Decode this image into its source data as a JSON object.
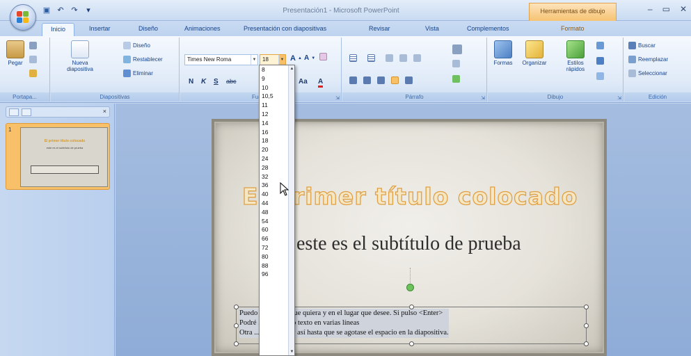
{
  "window": {
    "title": "Presentación1 - Microsoft PowerPoint",
    "context_tool": "Herramientas de dibujo",
    "controls": [
      "–",
      "▭",
      "✕"
    ]
  },
  "quick_access": [
    "save-icon",
    "undo-icon",
    "redo-icon",
    "customize-icon"
  ],
  "tabs": [
    {
      "label": "Inicio",
      "active": true
    },
    {
      "label": "Insertar"
    },
    {
      "label": "Diseño"
    },
    {
      "label": "Animaciones"
    },
    {
      "label": "Presentación con diapositivas"
    },
    {
      "label": "Revisar"
    },
    {
      "label": "Vista"
    },
    {
      "label": "Complementos"
    },
    {
      "label": "Formato",
      "contextual": true
    }
  ],
  "ribbon": {
    "clipboard": {
      "label": "Portapa...",
      "paste": "Pegar"
    },
    "slides": {
      "label": "Diapositivas",
      "new_slide": "Nueva diapositiva",
      "layout": "Diseño",
      "reset": "Restablecer",
      "delete": "Eliminar"
    },
    "font": {
      "label": "Fuente",
      "font_name": "Times New Roma",
      "font_size": "18",
      "bold": "N",
      "italic": "K",
      "underline": "S",
      "strike": "abc",
      "change_case": "Aa",
      "font_color": "A"
    },
    "paragraph": {
      "label": "Párrafo"
    },
    "drawing": {
      "label": "Dibujo",
      "shapes": "Formas",
      "arrange": "Organizar",
      "quick_styles": "Estilos rápidos"
    },
    "editing": {
      "label": "Edición",
      "find": "Buscar",
      "replace": "Reemplazar",
      "select": "Seleccionar"
    }
  },
  "font_sizes": [
    "8",
    "9",
    "10",
    "10,5",
    "11",
    "12",
    "14",
    "16",
    "18",
    "20",
    "24",
    "28",
    "32",
    "36",
    "40",
    "44",
    "48",
    "54",
    "60",
    "66",
    "72",
    "80",
    "88",
    "96"
  ],
  "slide": {
    "title": "El primer título colocado",
    "subtitle": "este es el subtítulo de prueba",
    "body_lines": [
      "Puedo ... el texto que quiera y en el lugar que desee. Si pulso <Enter>",
      "Podré ... scribiendo texto en varias líneas",
      "Otra ... a de texto y así hasta que se agotase el espacio en la diapositiva."
    ]
  },
  "thumbnail": {
    "number": "1",
    "title": "El primer título colocado",
    "subtitle": "este es el subtítulo de prueba"
  },
  "colors": {
    "accent_orange": "#f8c069",
    "ribbon_blue": "#15428b",
    "title_outline": "#e0a045"
  }
}
